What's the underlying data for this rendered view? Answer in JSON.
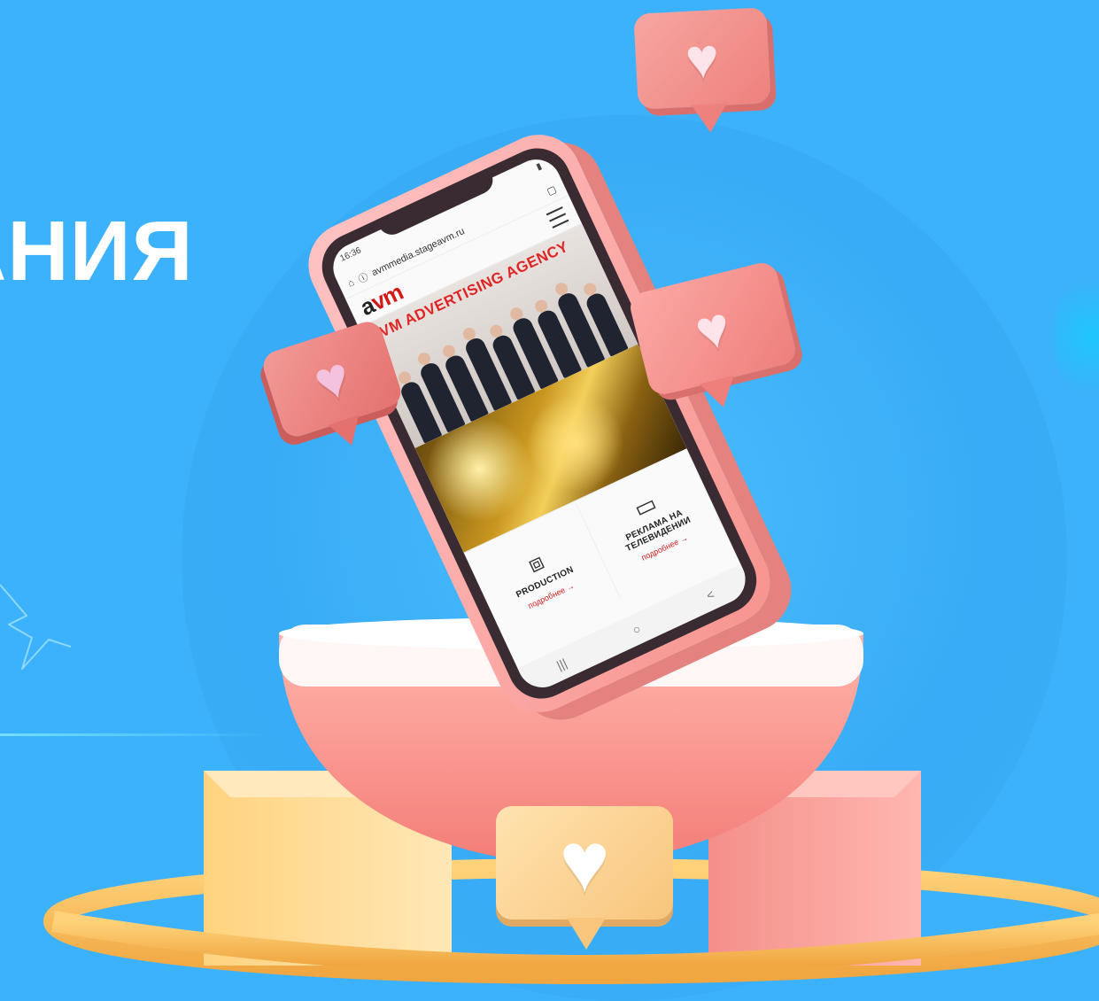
{
  "headline": "АНИЯ",
  "phone": {
    "status_time": "16:36",
    "url": "avmmedia.stageavm.ru",
    "logo": {
      "a": "a",
      "vm": "vm"
    },
    "hero_title": "AVM ADVERTISING AGENCY",
    "cards": [
      {
        "icon": "box-icon",
        "title": "PRODUCTION",
        "link": "подробнее →"
      },
      {
        "icon": "tv-icon",
        "title": "РЕКЛАМА НА ТЕЛЕВИДЕНИИ",
        "link": "подробнее →"
      }
    ],
    "sysnav": {
      "recent": "|||",
      "home": "○",
      "back": "<"
    }
  },
  "colors": {
    "background": "#3bb2fb",
    "phone": "#f7948f",
    "accent_red": "#d01b1b",
    "bubble_pink": "#ee817d",
    "bubble_yellow": "#f8c57c"
  }
}
